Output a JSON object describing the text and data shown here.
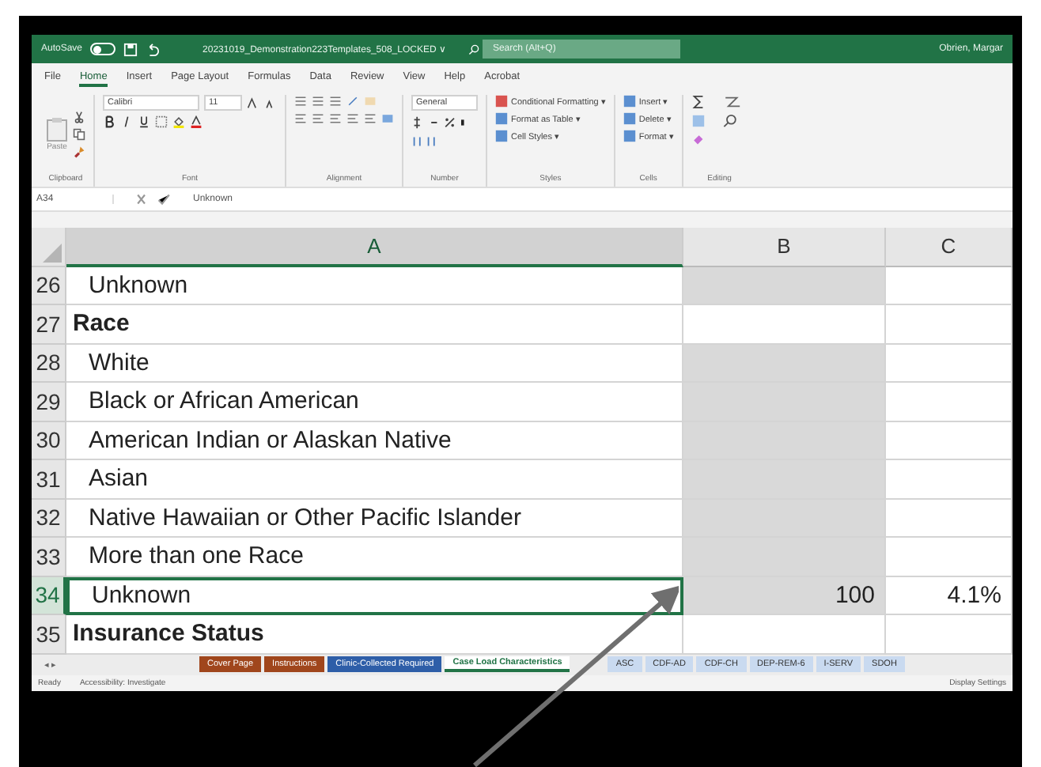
{
  "titlebar": {
    "autosave": "AutoSave",
    "autosave_on": false,
    "filename": "20231019_Demonstration223Templates_508_LOCKED ∨",
    "search": {
      "placeholder": "Search (Alt+Q)"
    },
    "user": "Obrien, Margar"
  },
  "ribbon_tabs": [
    {
      "label": "File",
      "selected": false
    },
    {
      "label": "Home",
      "selected": true
    },
    {
      "label": "Insert",
      "selected": false
    },
    {
      "label": "Page Layout",
      "selected": false
    },
    {
      "label": "Formulas",
      "selected": false
    },
    {
      "label": "Data",
      "selected": false
    },
    {
      "label": "Review",
      "selected": false
    },
    {
      "label": "View",
      "selected": false
    },
    {
      "label": "Help",
      "selected": false
    },
    {
      "label": "Acrobat",
      "selected": false
    }
  ],
  "ribbon": {
    "paste": "Paste",
    "font_name": "Calibri",
    "font_size": "11",
    "number_format": "General",
    "styles": [
      "Conditional Formatting ▾",
      "Format as Table ▾",
      "Cell Styles ▾"
    ],
    "cells": [
      "Insert ▾",
      "Delete ▾",
      "Format ▾"
    ],
    "groups": [
      "Clipboard",
      "Font",
      "Alignment",
      "Number",
      "Styles",
      "Cells",
      "Editing"
    ]
  },
  "formula_bar": {
    "name_box": "A34",
    "value": "Unknown"
  },
  "columns": [
    {
      "label": "A",
      "selected": true
    },
    {
      "label": "B",
      "selected": false
    },
    {
      "label": "C",
      "selected": false
    }
  ],
  "rows": [
    {
      "number": "26",
      "kind": "item",
      "a": "Unknown",
      "b": "",
      "c": "",
      "selected": false
    },
    {
      "number": "27",
      "kind": "section",
      "a": "Race",
      "b": "",
      "c": "",
      "selected": false
    },
    {
      "number": "28",
      "kind": "item",
      "a": "White",
      "b": "",
      "c": "",
      "selected": false
    },
    {
      "number": "29",
      "kind": "item",
      "a": "Black or African American",
      "b": "",
      "c": "",
      "selected": false
    },
    {
      "number": "30",
      "kind": "item",
      "a": "American Indian or Alaskan Native",
      "b": "",
      "c": "",
      "selected": false
    },
    {
      "number": "31",
      "kind": "item",
      "a": "Asian",
      "b": "",
      "c": "",
      "selected": false
    },
    {
      "number": "32",
      "kind": "item",
      "a": "Native Hawaiian or Other Pacific Islander",
      "b": "",
      "c": "",
      "selected": false
    },
    {
      "number": "33",
      "kind": "item",
      "a": "More than one Race",
      "b": "",
      "c": "",
      "selected": false
    },
    {
      "number": "34",
      "kind": "item",
      "a": "Unknown",
      "b": "100",
      "c": "4.1%",
      "selected": true
    },
    {
      "number": "35",
      "kind": "section",
      "a": "Insurance Status",
      "b": "",
      "c": "",
      "selected": false
    }
  ],
  "sheet_nav": "◂ ▸",
  "sheet_tabs": [
    {
      "label": "Cover Page",
      "color": "#a0461c",
      "selected": false
    },
    {
      "label": "Instructions",
      "color": "#a0461c",
      "selected": false
    },
    {
      "label": "Clinic-Collected Required",
      "color": "#2e5ea8",
      "selected": false
    },
    {
      "label": "Case Load Characteristics",
      "color": "#ffffff",
      "selected": true
    },
    {
      "label": "ASC",
      "color": "#c9daf0",
      "selected": false
    },
    {
      "label": "CDF-AD",
      "color": "#c9daf0",
      "selected": false
    },
    {
      "label": "CDF-CH",
      "color": "#c9daf0",
      "selected": false
    },
    {
      "label": "DEP-REM-6",
      "color": "#c9daf0",
      "selected": false
    },
    {
      "label": "I-SERV",
      "color": "#c9daf0",
      "selected": false
    },
    {
      "label": "SDOH",
      "color": "#c9daf0",
      "selected": false
    }
  ],
  "status_bar": {
    "ready": "Ready",
    "accessibility": "Accessibility: Investigate",
    "display": "Display Settings"
  }
}
